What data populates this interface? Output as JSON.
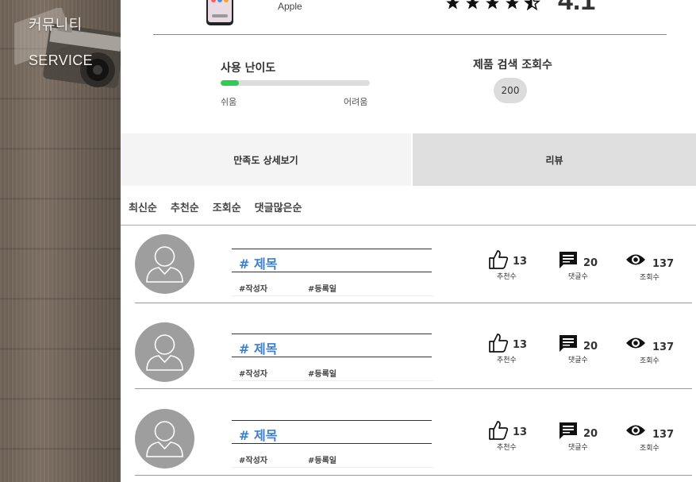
{
  "sidebar": {
    "items": [
      {
        "label": "커뮤니티"
      },
      {
        "label": "SERVICE"
      }
    ]
  },
  "product": {
    "brand": "Apple",
    "rating": "4.1",
    "stars_filled": 4.5
  },
  "difficulty": {
    "title": "사용 난이도",
    "level": 0.12,
    "easy_label": "쉬움",
    "hard_label": "어려움"
  },
  "search_views": {
    "title": "제품 검색 조회수",
    "value": "200"
  },
  "tabs": [
    {
      "label": "만족도 상세보기",
      "active": false
    },
    {
      "label": "리뷰",
      "active": true
    }
  ],
  "sort": [
    "최신순",
    "추천순",
    "조회순",
    "댓글많은순"
  ],
  "reviews": [
    {
      "title": "# 제목",
      "author": "#작성자",
      "date": "#등록일",
      "likes": "13",
      "likes_label": "추천수",
      "comments": "20",
      "comments_label": "댓글수",
      "views": "137",
      "views_label": "조회수"
    },
    {
      "title": "# 제목",
      "author": "#작성자",
      "date": "#등록일",
      "likes": "13",
      "likes_label": "추천수",
      "comments": "20",
      "comments_label": "댓글수",
      "views": "137",
      "views_label": "조회수"
    },
    {
      "title": "# 제목",
      "author": "#작성자",
      "date": "#등록일",
      "likes": "13",
      "likes_label": "추천수",
      "comments": "20",
      "comments_label": "댓글수",
      "views": "137",
      "views_label": "조회수"
    }
  ],
  "icons": {
    "like": "thumbs-up-icon",
    "comment": "comment-icon",
    "view": "eye-icon",
    "avatar": "user-avatar-icon"
  },
  "colors": {
    "accent_title": "#3a7fd0",
    "difficulty_fill": "#2ecc52"
  }
}
